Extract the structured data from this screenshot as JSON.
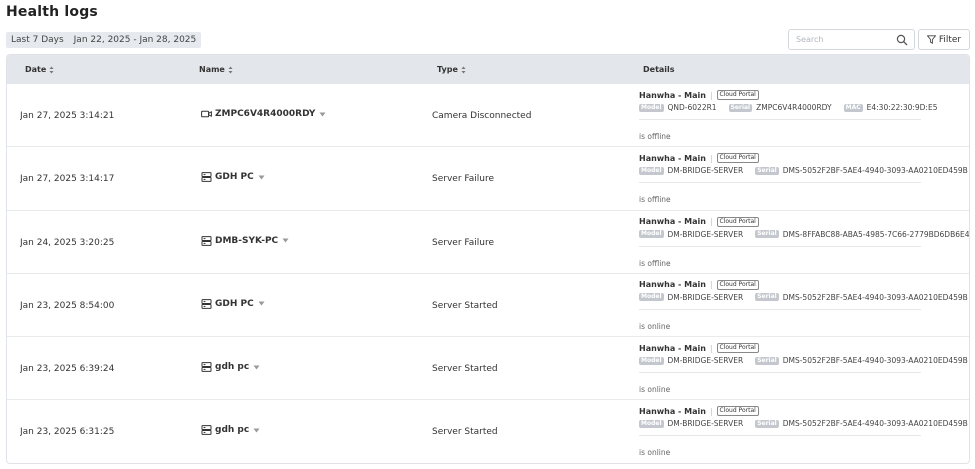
{
  "page": {
    "title": "Health  logs"
  },
  "date_filter": {
    "range_label": "Last 7 Days",
    "range_value": "Jan 22, 2025 - Jan 28, 2025"
  },
  "search": {
    "placeholder": "Search",
    "value": ""
  },
  "filter_button": {
    "label": "Filter"
  },
  "table": {
    "headers": {
      "date": "Date",
      "name": "Name",
      "type": "Type",
      "details": "Details"
    },
    "rows": [
      {
        "date": "Jan 27, 2025 3:14:21 AM",
        "device_icon": "camera-icon",
        "name": "ZMPC6V4R4000RDY",
        "type": "Camera Disconnected",
        "site": "Hanwha - Main",
        "portal": "Cloud Portal",
        "model_tag": "Model",
        "model": "QND-6022R1",
        "serial_tag": "Serial",
        "serial": "ZMPC6V4R4000RDY",
        "mac_tag": "MAC",
        "mac": "E4:30:22:30:9D:E5",
        "status": "is offline"
      },
      {
        "date": "Jan 27, 2025 3:14:17 AM",
        "device_icon": "server-icon",
        "name": "GDH PC",
        "type": "Server Failure",
        "site": "Hanwha - Main",
        "portal": "Cloud Portal",
        "model_tag": "Model",
        "model": "DM-BRIDGE-SERVER",
        "serial_tag": "Serial",
        "serial": "DMS-5052F2BF-5AE4-4940-3093-AA0210ED459B",
        "status": "is offline"
      },
      {
        "date": "Jan 24, 2025 3:20:25 AM",
        "device_icon": "server-icon",
        "name": "DMB-SYK-PC",
        "type": "Server Failure",
        "site": "Hanwha - Main",
        "portal": "Cloud Portal",
        "model_tag": "Model",
        "model": "DM-BRIDGE-SERVER",
        "serial_tag": "Serial",
        "serial": "DMS-8FFABC88-ABA5-4985-7C66-2779BD6DB6E4",
        "status": "is offline"
      },
      {
        "date": "Jan 23, 2025 8:54:00 PM",
        "device_icon": "server-icon",
        "name": "GDH PC",
        "type": "Server Started",
        "site": "Hanwha - Main",
        "portal": "Cloud Portal",
        "model_tag": "Model",
        "model": "DM-BRIDGE-SERVER",
        "serial_tag": "Serial",
        "serial": "DMS-5052F2BF-5AE4-4940-3093-AA0210ED459B",
        "status": "is online"
      },
      {
        "date": "Jan 23, 2025 6:39:24 PM",
        "device_icon": "server-icon",
        "name": "gdh pc",
        "type": "Server Started",
        "site": "Hanwha - Main",
        "portal": "Cloud Portal",
        "model_tag": "Model",
        "model": "DM-BRIDGE-SERVER",
        "serial_tag": "Serial",
        "serial": "DMS-5052F2BF-5AE4-4940-3093-AA0210ED459B",
        "status": "is online"
      },
      {
        "date": "Jan 23, 2025 6:31:25 PM",
        "device_icon": "server-icon",
        "name": "gdh pc",
        "type": "Server Started",
        "site": "Hanwha - Main",
        "portal": "Cloud Portal",
        "model_tag": "Model",
        "model": "DM-BRIDGE-SERVER",
        "serial_tag": "Serial",
        "serial": "DMS-5052F2BF-5AE4-4940-3093-AA0210ED459B",
        "status": "is online"
      }
    ]
  }
}
